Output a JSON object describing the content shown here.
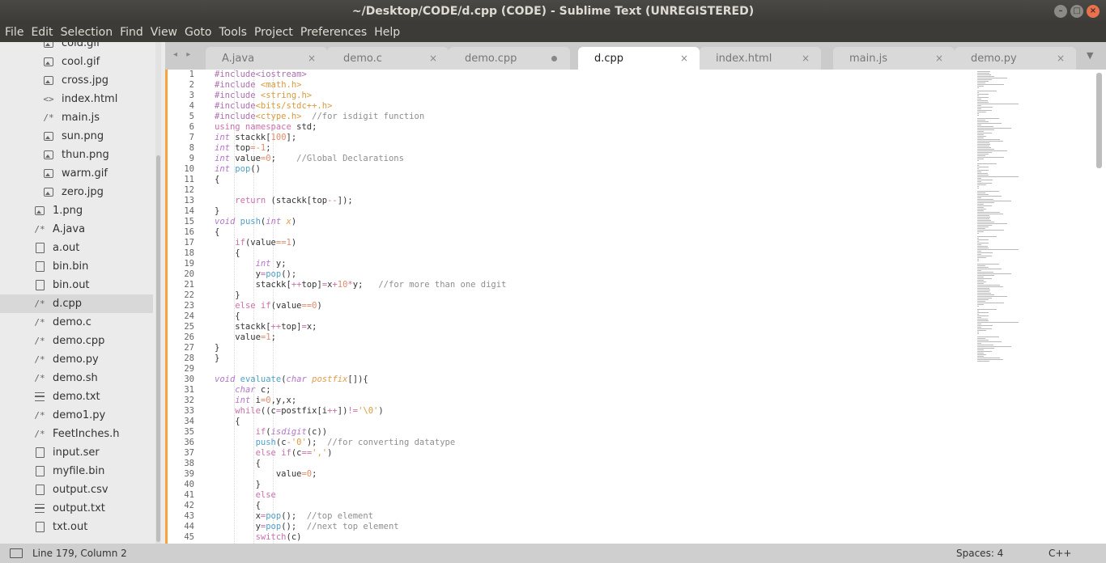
{
  "window": {
    "title": "~/Desktop/CODE/d.cpp (CODE) - Sublime Text (UNREGISTERED)",
    "buttons": {
      "minimize": "–",
      "maximize": "□",
      "close": "×"
    }
  },
  "menu": [
    "File",
    "Edit",
    "Selection",
    "Find",
    "View",
    "Goto",
    "Tools",
    "Project",
    "Preferences",
    "Help"
  ],
  "sidebar": {
    "items": [
      {
        "label": "cold.gif",
        "icon": "image-icon",
        "depth": 1
      },
      {
        "label": "cool.gif",
        "icon": "image-icon",
        "depth": 1
      },
      {
        "label": "cross.jpg",
        "icon": "image-icon",
        "depth": 1
      },
      {
        "label": "index.html",
        "icon": "markup-icon",
        "depth": 1
      },
      {
        "label": "main.js",
        "icon": "comment-icon",
        "depth": 1
      },
      {
        "label": "sun.png",
        "icon": "image-icon",
        "depth": 1
      },
      {
        "label": "thun.png",
        "icon": "image-icon",
        "depth": 1
      },
      {
        "label": "warm.gif",
        "icon": "image-icon",
        "depth": 1
      },
      {
        "label": "zero.jpg",
        "icon": "image-icon",
        "depth": 1
      },
      {
        "label": "1.png",
        "icon": "image-icon",
        "depth": 0
      },
      {
        "label": "A.java",
        "icon": "comment-icon",
        "depth": 0
      },
      {
        "label": "a.out",
        "icon": "file-icon",
        "depth": 0
      },
      {
        "label": "bin.bin",
        "icon": "file-icon",
        "depth": 0
      },
      {
        "label": "bin.out",
        "icon": "file-icon",
        "depth": 0
      },
      {
        "label": "d.cpp",
        "icon": "comment-icon",
        "depth": 0,
        "selected": true
      },
      {
        "label": "demo.c",
        "icon": "comment-icon",
        "depth": 0
      },
      {
        "label": "demo.cpp",
        "icon": "comment-icon",
        "depth": 0
      },
      {
        "label": "demo.py",
        "icon": "comment-icon",
        "depth": 0
      },
      {
        "label": "demo.sh",
        "icon": "comment-icon",
        "depth": 0
      },
      {
        "label": "demo.txt",
        "icon": "lines-icon",
        "depth": 0
      },
      {
        "label": "demo1.py",
        "icon": "comment-icon",
        "depth": 0
      },
      {
        "label": "FeetInches.h",
        "icon": "comment-icon",
        "depth": 0
      },
      {
        "label": "input.ser",
        "icon": "file-icon",
        "depth": 0
      },
      {
        "label": "myfile.bin",
        "icon": "file-icon",
        "depth": 0
      },
      {
        "label": "output.csv",
        "icon": "file-icon",
        "depth": 0
      },
      {
        "label": "output.txt",
        "icon": "lines-icon",
        "depth": 0
      },
      {
        "label": "txt.out",
        "icon": "file-icon",
        "depth": 0
      }
    ]
  },
  "tabs": {
    "nav": "◂ ▸",
    "overflow": "▼",
    "items": [
      {
        "label": "A.java",
        "state": "close"
      },
      {
        "label": "demo.c",
        "state": "close"
      },
      {
        "label": "demo.cpp",
        "state": "dirty"
      },
      {
        "label": "d.cpp",
        "state": "close",
        "active": true
      },
      {
        "label": "index.html",
        "state": "close"
      },
      {
        "label": "main.js",
        "state": "close"
      },
      {
        "label": "demo.py",
        "state": "close"
      }
    ],
    "close_glyph": "×"
  },
  "editor": {
    "first_line": 1,
    "lines": [
      [
        [
          "#include<iostream>",
          "pp"
        ]
      ],
      [
        [
          "#include ",
          "pp"
        ],
        [
          "<math.h>",
          "str"
        ]
      ],
      [
        [
          "#include ",
          "pp"
        ],
        [
          "<string.h>",
          "str"
        ]
      ],
      [
        [
          "#include",
          "pp"
        ],
        [
          "<bits/stdc++.h>",
          "str"
        ]
      ],
      [
        [
          "#include",
          "pp"
        ],
        [
          "<ctype.h>",
          "str"
        ],
        [
          "  //for isdigit function",
          "cm"
        ]
      ],
      [
        [
          "using namespace",
          "kw"
        ],
        [
          " std;",
          "tx"
        ]
      ],
      [
        [
          "int",
          "ty"
        ],
        [
          " stackk[",
          "tx"
        ],
        [
          "100",
          "num"
        ],
        [
          "];",
          "tx"
        ]
      ],
      [
        [
          "int",
          "ty"
        ],
        [
          " top",
          "tx"
        ],
        [
          "=-1",
          "num"
        ],
        [
          ";",
          "tx"
        ]
      ],
      [
        [
          "int",
          "ty"
        ],
        [
          " value",
          "tx"
        ],
        [
          "=0",
          "num"
        ],
        [
          ";    ",
          "tx"
        ],
        [
          "//Global Declarations",
          "cm"
        ]
      ],
      [
        [
          "int",
          "ty"
        ],
        [
          " ",
          "tx"
        ],
        [
          "pop",
          "fn"
        ],
        [
          "()",
          "tx"
        ]
      ],
      [
        [
          "{",
          "tx"
        ]
      ],
      [
        [
          "",
          "tx"
        ]
      ],
      [
        [
          "    ",
          "tx"
        ],
        [
          "return",
          "kw"
        ],
        [
          " (stackk[top",
          "tx"
        ],
        [
          "--",
          "kw"
        ],
        [
          "]);",
          "tx"
        ]
      ],
      [
        [
          "}",
          "tx"
        ]
      ],
      [
        [
          "void",
          "ty"
        ],
        [
          " ",
          "tx"
        ],
        [
          "push",
          "fn"
        ],
        [
          "(",
          "tx"
        ],
        [
          "int",
          "ty"
        ],
        [
          " ",
          "tx"
        ],
        [
          "x",
          "arg"
        ],
        [
          ")",
          "tx"
        ]
      ],
      [
        [
          "{",
          "tx"
        ]
      ],
      [
        [
          "    ",
          "tx"
        ],
        [
          "if",
          "kw"
        ],
        [
          "(value",
          "tx"
        ],
        [
          "==1",
          "num"
        ],
        [
          ")",
          "tx"
        ]
      ],
      [
        [
          "    {",
          "tx"
        ]
      ],
      [
        [
          "        ",
          "tx"
        ],
        [
          "int",
          "ty"
        ],
        [
          " y;",
          "tx"
        ]
      ],
      [
        [
          "        y",
          "tx"
        ],
        [
          "=",
          "kw"
        ],
        [
          "pop",
          "fn"
        ],
        [
          "();",
          "tx"
        ]
      ],
      [
        [
          "        stackk[",
          "tx"
        ],
        [
          "++",
          "kw"
        ],
        [
          "top]",
          "tx"
        ],
        [
          "=",
          "kw"
        ],
        [
          "x",
          "tx"
        ],
        [
          "+",
          "kw"
        ],
        [
          "10",
          "num"
        ],
        [
          "*",
          "kw"
        ],
        [
          "y;   ",
          "tx"
        ],
        [
          "//for more than one digit",
          "cm"
        ]
      ],
      [
        [
          "    }",
          "tx"
        ]
      ],
      [
        [
          "    ",
          "tx"
        ],
        [
          "else if",
          "kw"
        ],
        [
          "(value",
          "tx"
        ],
        [
          "==0",
          "num"
        ],
        [
          ")",
          "tx"
        ]
      ],
      [
        [
          "    {",
          "tx"
        ]
      ],
      [
        [
          "    stackk[",
          "tx"
        ],
        [
          "++",
          "kw"
        ],
        [
          "top]",
          "tx"
        ],
        [
          "=",
          "kw"
        ],
        [
          "x;",
          "tx"
        ]
      ],
      [
        [
          "    value",
          "tx"
        ],
        [
          "=1",
          "num"
        ],
        [
          ";",
          "tx"
        ]
      ],
      [
        [
          "}",
          "tx"
        ]
      ],
      [
        [
          "}",
          "tx"
        ]
      ],
      [
        [
          "",
          "tx"
        ]
      ],
      [
        [
          "void",
          "ty"
        ],
        [
          " ",
          "tx"
        ],
        [
          "evaluate",
          "fn"
        ],
        [
          "(",
          "tx"
        ],
        [
          "char",
          "ty"
        ],
        [
          " ",
          "tx"
        ],
        [
          "postfix",
          "arg"
        ],
        [
          "[]){",
          "tx"
        ]
      ],
      [
        [
          "    ",
          "tx"
        ],
        [
          "char",
          "ty"
        ],
        [
          " c;",
          "tx"
        ]
      ],
      [
        [
          "    ",
          "tx"
        ],
        [
          "int",
          "ty"
        ],
        [
          " i",
          "tx"
        ],
        [
          "=0",
          "num"
        ],
        [
          ",y,x;",
          "tx"
        ]
      ],
      [
        [
          "    ",
          "tx"
        ],
        [
          "while",
          "kw"
        ],
        [
          "((c",
          "tx"
        ],
        [
          "=",
          "kw"
        ],
        [
          "postfix[i",
          "tx"
        ],
        [
          "++",
          "kw"
        ],
        [
          "])",
          "tx"
        ],
        [
          "!=",
          "kw"
        ],
        [
          "'\\0'",
          "str"
        ],
        [
          ")",
          "tx"
        ]
      ],
      [
        [
          "    {",
          "tx"
        ]
      ],
      [
        [
          "        ",
          "tx"
        ],
        [
          "if",
          "kw"
        ],
        [
          "(",
          "tx"
        ],
        [
          "isdigit",
          "sp"
        ],
        [
          "(c))",
          "tx"
        ]
      ],
      [
        [
          "        ",
          "tx"
        ],
        [
          "push",
          "fn"
        ],
        [
          "(c",
          "tx"
        ],
        [
          "-",
          "kw"
        ],
        [
          "'0'",
          "str"
        ],
        [
          ");  ",
          "tx"
        ],
        [
          "//for converting datatype",
          "cm"
        ]
      ],
      [
        [
          "        ",
          "tx"
        ],
        [
          "else if",
          "kw"
        ],
        [
          "(c",
          "tx"
        ],
        [
          "==",
          "kw"
        ],
        [
          "','",
          "str"
        ],
        [
          ")",
          "tx"
        ]
      ],
      [
        [
          "        {",
          "tx"
        ]
      ],
      [
        [
          "            value",
          "tx"
        ],
        [
          "=0",
          "num"
        ],
        [
          ";",
          "tx"
        ]
      ],
      [
        [
          "        }",
          "tx"
        ]
      ],
      [
        [
          "        ",
          "tx"
        ],
        [
          "else",
          "kw"
        ]
      ],
      [
        [
          "        {",
          "tx"
        ]
      ],
      [
        [
          "        x",
          "tx"
        ],
        [
          "=",
          "kw"
        ],
        [
          "pop",
          "fn"
        ],
        [
          "();  ",
          "tx"
        ],
        [
          "//top element",
          "cm"
        ]
      ],
      [
        [
          "        y",
          "tx"
        ],
        [
          "=",
          "kw"
        ],
        [
          "pop",
          "fn"
        ],
        [
          "();  ",
          "tx"
        ],
        [
          "//next top element",
          "cm"
        ]
      ],
      [
        [
          "        ",
          "tx"
        ],
        [
          "switch",
          "kw"
        ],
        [
          "(c)",
          "tx"
        ]
      ]
    ],
    "colors": {
      "pp": "#ad6fb0",
      "str": "#d99a3e",
      "cm": "#8e8e8e",
      "kw": "#cc6fab",
      "ty": "#b574c9",
      "num": "#e68a6a",
      "fn": "#4fa0c7",
      "arg": "#e39c4a",
      "sp": "#b574c9",
      "tx": "#333333"
    }
  },
  "status": {
    "position": "Line 179, Column 2",
    "spaces": "Spaces: 4",
    "syntax": "C++"
  }
}
